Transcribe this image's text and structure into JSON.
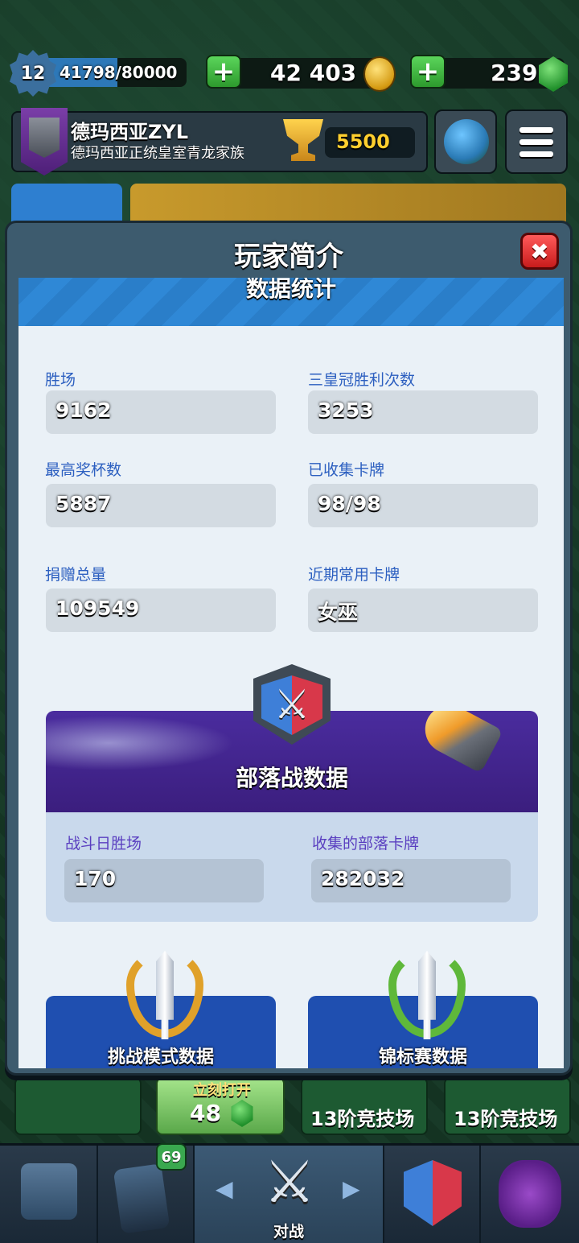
{
  "header": {
    "level": "12",
    "xp_text": "41798/80000",
    "xp_progress": 0.522,
    "gold": "42 403",
    "gems": "239",
    "plus_label": "+"
  },
  "player": {
    "name": "德玛西亚ZYL",
    "clan": "德玛西亚正统皇室青龙家族",
    "trophies": "5500"
  },
  "modal": {
    "title": "玩家简介",
    "close_label": "✖",
    "section_title": "数据统计",
    "stats": [
      {
        "label": "胜场",
        "value": "9162"
      },
      {
        "label": "三皇冠胜利次数",
        "value": "3253"
      },
      {
        "label": "最高奖杯数",
        "value": "5887"
      },
      {
        "label": "已收集卡牌",
        "value": "98/98"
      },
      {
        "label": "捐赠总量",
        "value": "109549"
      },
      {
        "label": "近期常用卡牌",
        "value": "女巫"
      }
    ],
    "clan_war": {
      "title": "部落战数据",
      "stats": [
        {
          "label": "战斗日胜场",
          "value": "170"
        },
        {
          "label": "收集的部落卡牌",
          "value": "282032"
        }
      ]
    },
    "challenge_button": "挑战模式数据",
    "tournament_button": "锦标赛数据"
  },
  "chests": {
    "unlock_label": "立刻打开",
    "unlock_cost": "48",
    "arena_1": "13阶竞技场",
    "arena_2": "13阶竞技场"
  },
  "nav": {
    "cards_badge": "69",
    "battle_label": "对战",
    "left_arrow": "◀",
    "right_arrow": "▶"
  },
  "colors": {
    "accent_blue": "#2c5fc0",
    "clan_war_purple": "#4a2c9e",
    "close_red": "#e02a2a",
    "gem_green": "#2da33a"
  }
}
